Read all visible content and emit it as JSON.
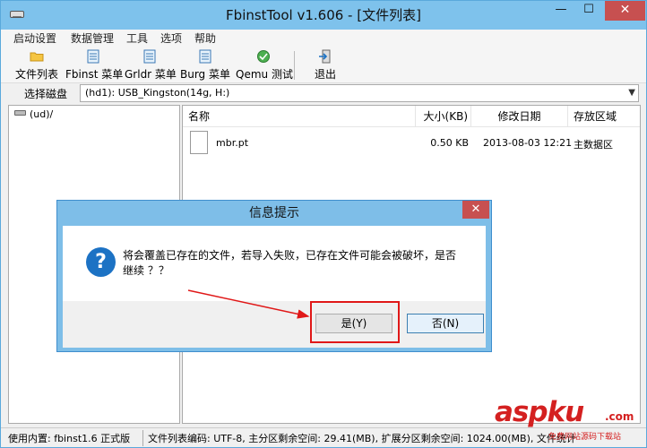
{
  "window": {
    "title": "FbinstTool v1.606 - [文件列表]",
    "minimize": "—",
    "maximize": "☐",
    "close": "✕"
  },
  "menu": [
    "启动设置",
    "数据管理",
    "工具",
    "选项",
    "帮助"
  ],
  "toolbar": [
    {
      "label": "文件列表",
      "icon": "folder-icon"
    },
    {
      "label": "Fbinst 菜单",
      "icon": "document-icon"
    },
    {
      "label": "Grldr 菜单",
      "icon": "document-icon"
    },
    {
      "label": "Burg 菜单",
      "icon": "document-icon"
    },
    {
      "label": "Qemu 测试",
      "icon": "globe-icon"
    },
    {
      "label": "退出",
      "icon": "exit-icon"
    }
  ],
  "disk": {
    "label": "选择磁盘",
    "value": "(hd1): USB_Kingston(14g, H:)"
  },
  "tree": {
    "root": "(ud)/"
  },
  "file_list": {
    "columns": [
      "名称",
      "大小(KB)",
      "修改日期",
      "存放区域"
    ],
    "rows": [
      {
        "name": "mbr.pt",
        "size": "0.50 KB",
        "date": "2013-08-03 12:21",
        "area": "主数据区"
      }
    ]
  },
  "status": {
    "left": "使用内置: fbinst1.6 正式版",
    "right": "文件列表编码: UTF-8, 主分区剩余空间: 29.41(MB), 扩展分区剩余空间: 1024.00(MB), 文件统计"
  },
  "dialog": {
    "title": "信息提示",
    "close": "✕",
    "icon_glyph": "?",
    "message": "将会覆盖已存在的文件，若导入失败，已存在文件可能会被破坏，是否继续 ？？",
    "yes": "是(Y)",
    "no": "否(N)"
  },
  "watermark": {
    "brand": "aspku",
    "tld": ".com",
    "sub": "免费网站源码下载站"
  },
  "colors": {
    "title_bar": "#7ec2ec",
    "close_red": "#c75050",
    "highlight_red": "#e01818",
    "question_blue": "#1c72c4"
  }
}
